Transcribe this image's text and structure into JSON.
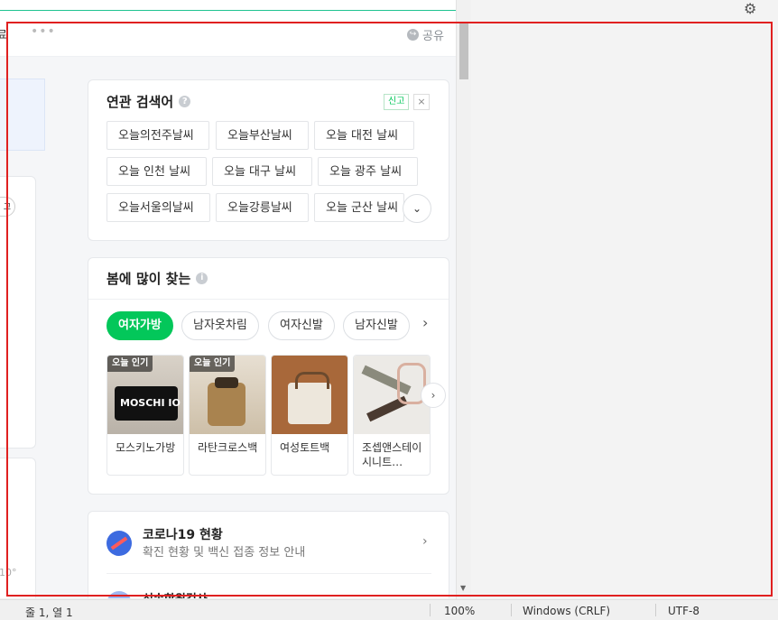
{
  "topbar": {
    "edge_text": "료",
    "dots": "•••",
    "share_label": "공유"
  },
  "related": {
    "title": "연관 검색어",
    "help_icon": "?",
    "report_label": "신고",
    "close_icon": "×",
    "keywords": [
      "오늘의전주날씨",
      "오늘부산날씨",
      "오늘 대전 날씨",
      "오늘 인천 날씨",
      "오늘 대구 날씨",
      "오늘 광주 날씨",
      "오늘서울의날씨",
      "오늘강릉날씨",
      "오늘 군산 날씨"
    ],
    "expand_icon": "⌄"
  },
  "spring": {
    "title": "봄에 많이 찾는",
    "info_icon": "i",
    "tabs": [
      "여자가방",
      "남자옷차림",
      "여자신발",
      "남자신발"
    ],
    "next_icon": "›",
    "products": [
      {
        "badge": "오늘 인기",
        "name": "모스키노가방",
        "img_text": "MOSCHI IO"
      },
      {
        "badge": "오늘 인기",
        "name": "라탄크로스백",
        "img_text": ""
      },
      {
        "badge": "",
        "name": "여성토트백",
        "img_text": ""
      },
      {
        "badge": "",
        "name": "조셉앤스테이시니트…",
        "img_text": ""
      }
    ],
    "products_next_icon": "›"
  },
  "covid": {
    "title": "코로나19 현황",
    "subtitle": "확진 현황 및 백신 접종 정보 안내",
    "arrow": "›",
    "next_title": "신속항원검사"
  },
  "left_fragments": {
    "pill_text": "고",
    "temp_text": "10°"
  },
  "scroll": {
    "down": "▼",
    "right": "▶"
  },
  "statusbar": {
    "position": "줄 1, 열 1",
    "zoom": "100%",
    "line_ending": "Windows (CRLF)",
    "encoding": "UTF-8"
  },
  "right_pane": {
    "gear_icon": "⚙"
  },
  "colors": {
    "accent_green": "#03c75a",
    "highlight_red": "#e02020",
    "covid_blue": "#3d6be0"
  }
}
